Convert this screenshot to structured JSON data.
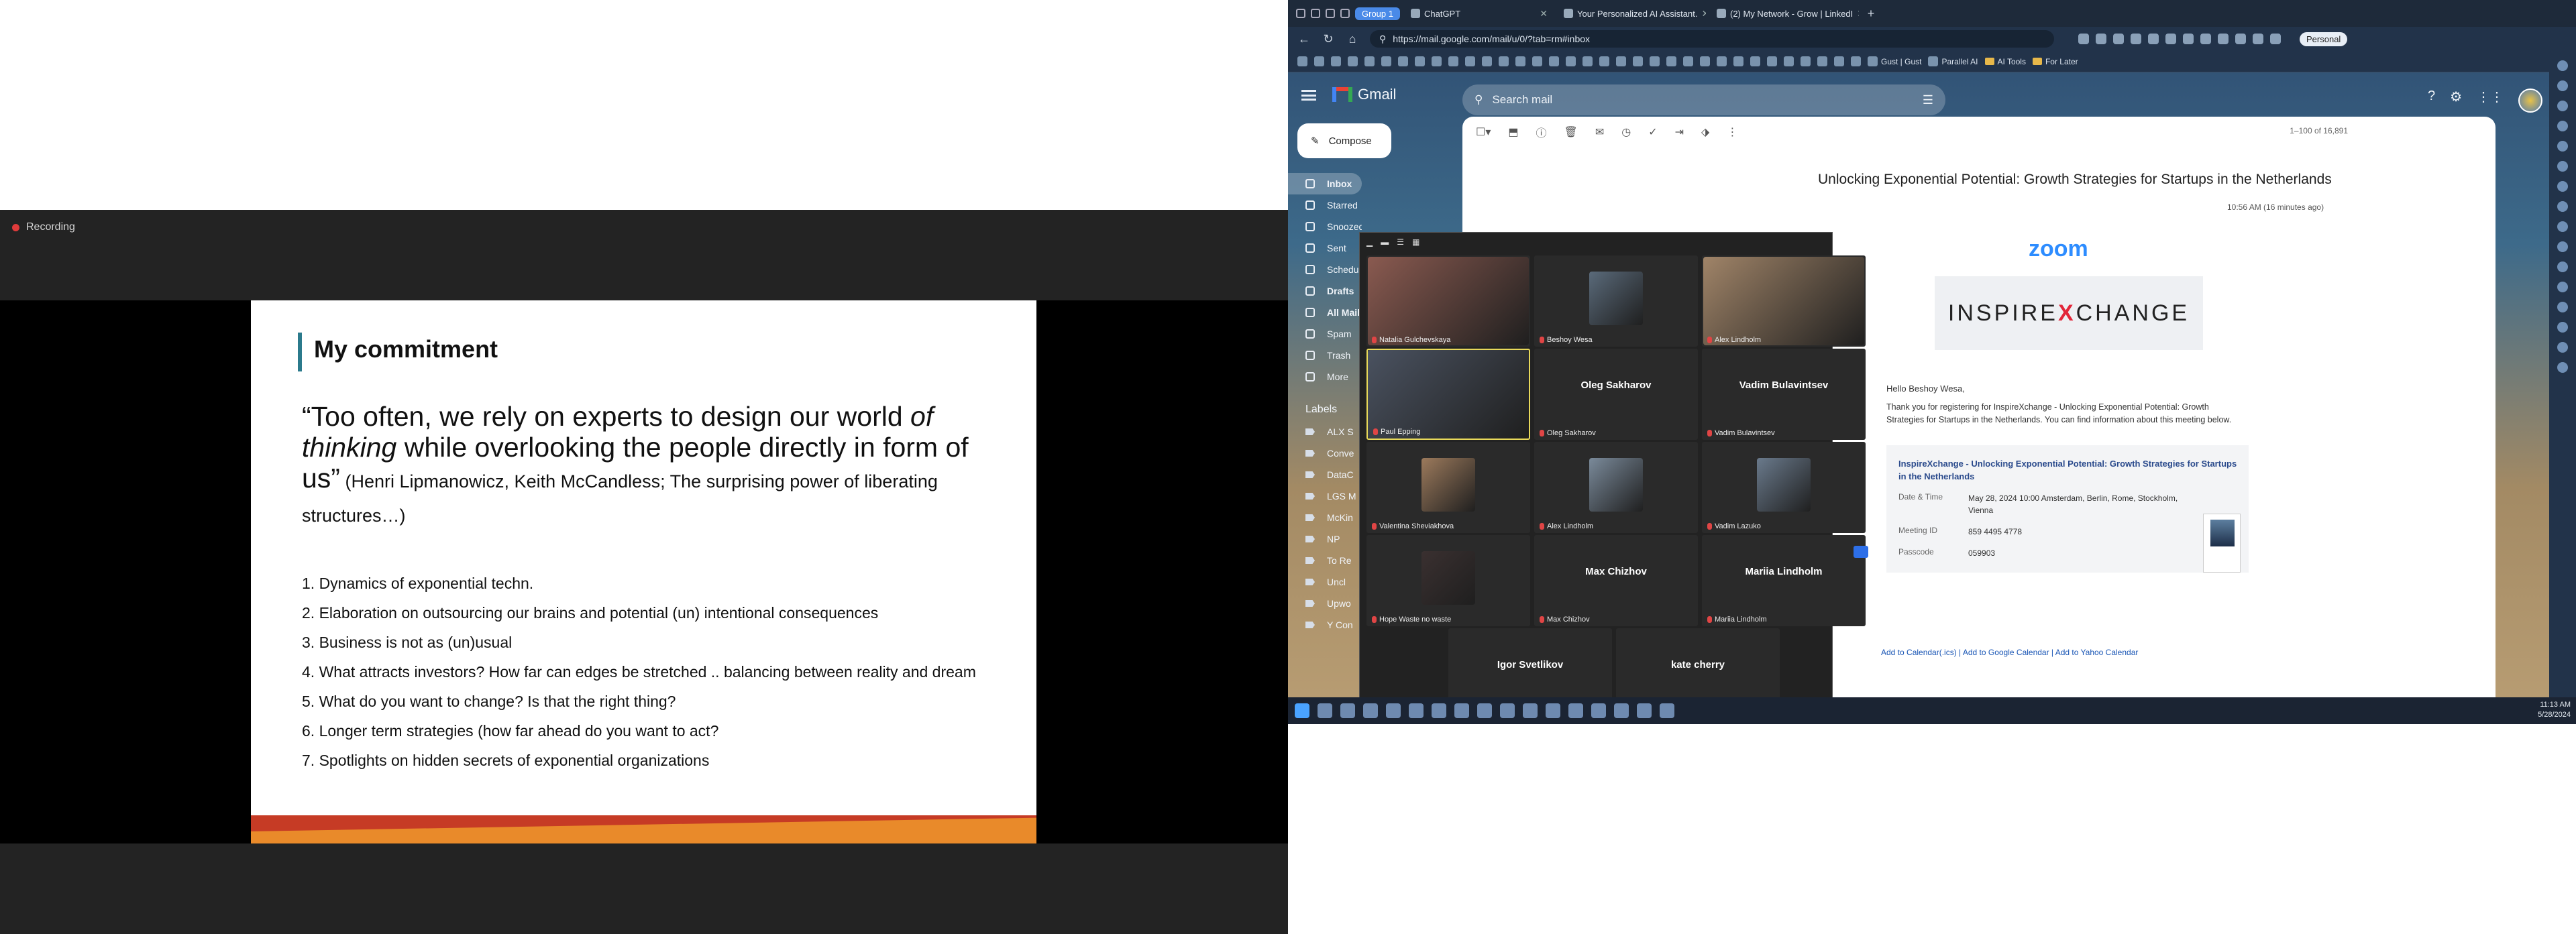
{
  "zoom": {
    "recording_label": "Recording",
    "slide": {
      "title": "My commitment",
      "quote_part1": "“Too often, we rely on experts to design our world ",
      "quote_em1": "of thinking",
      "quote_part2": " while overlooking the people directly in form of us”",
      "quote_cite": " (Henri Lipmanowicz, Keith McCandless; The surprising power of liberating structures…)",
      "items": [
        "1. Dynamics of exponential techn.",
        "2. Elaboration on outsourcing our brains and potential (un) intentional consequences",
        "3. Business is not as (un)usual",
        "4. What attracts investors? How far can edges be stretched .. balancing between reality and dream",
        "5. What do you want to change? Is that the right thing?",
        "6. Longer term strategies (how far ahead do you want to act?",
        "7. Spotlights on hidden secrets of exponential organizations"
      ]
    }
  },
  "browser": {
    "tab_group": "Group 1",
    "tabs": [
      "ChatGPT",
      "Your Personalized AI Assistant.",
      "(2) My Network - Grow | LinkedI"
    ],
    "url": "https://mail.google.com/mail/u/0/?tab=rm#inbox",
    "profile": "Personal",
    "bookmarks": [
      "Gust | Gust",
      "Parallel AI",
      "AI Tools",
      "For Later"
    ]
  },
  "gmail": {
    "app_name": "Gmail",
    "search_placeholder": "Search mail",
    "compose": "Compose",
    "nav": [
      "Inbox",
      "Starred",
      "Snoozed",
      "Sent",
      "Scheduled",
      "Drafts",
      "All Mail",
      "Spam",
      "Trash",
      "More"
    ],
    "labels_header": "Labels",
    "labels": [
      "ALX S",
      "Conve",
      "DataC",
      "LGS M",
      "McKin",
      "NP",
      "To Re",
      "Uncl",
      "Upwo",
      "Y Con"
    ],
    "count": "1–100 of 16,891",
    "subject": "Unlocking Exponential Potential: Growth Strategies for Startups in the Netherlands",
    "time": "10:56 AM (16 minutes ago)",
    "email": {
      "brand": "zoom",
      "banner_left": "INSPIRE",
      "banner_x": "X",
      "banner_right": "CHANGE",
      "greeting": "Hello Beshoy Wesa,",
      "thanks": "Thank you for registering for InspireXchange - Unlocking Exponential Potential: Growth Strategies for Startups in the Netherlands. You can find information about this meeting below.",
      "info_title": "InspireXchange - Unlocking Exponential Potential: Growth Strategies for Startups in the Netherlands",
      "date_key": "Date & Time",
      "date_val": "May 28, 2024 10:00 Amsterdam, Berlin, Rome, Stockholm, Vienna",
      "id_key": "Meeting ID",
      "id_val": "859 4495 4778",
      "pass_key": "Passcode",
      "pass_val": "059903",
      "cal_links": "Add to Calendar(.ics)  |  Add to Google Calendar  |  Add to Yahoo Calendar"
    }
  },
  "gallery": {
    "participants": [
      {
        "name": "Natalia Gulchevskaya",
        "big": false,
        "photo": "#8a5a50"
      },
      {
        "name": "Beshoy Wesa",
        "big": false,
        "photo": "#5a6a7a"
      },
      {
        "name": "Alex Lindholm",
        "big": false,
        "photo": "#a08468"
      },
      {
        "name": "Paul Epping",
        "big": false,
        "photo": "#4a5260"
      },
      {
        "name": "Oleg Sakharov",
        "big": true,
        "photo": ""
      },
      {
        "name": "Vadim Bulavintsev",
        "big": true,
        "photo": ""
      },
      {
        "name": "Valentina Sheviakhova",
        "big": false,
        "photo": "#9c7a5c"
      },
      {
        "name": "Alex Lindholm",
        "big": false,
        "photo": "#7a8a9a"
      },
      {
        "name": "Vadim Lazuko",
        "big": false,
        "photo": "#6a7a8c"
      },
      {
        "name": "Hope Waste no waste",
        "big": false,
        "photo": "#3a3030"
      },
      {
        "name": "Max Chizhov",
        "big": true,
        "photo": ""
      },
      {
        "name": "Mariia Lindholm",
        "big": true,
        "photo": ""
      },
      {
        "name": "Igor Svetlikov",
        "big": true,
        "photo": ""
      },
      {
        "name": "kate cherry",
        "big": true,
        "photo": ""
      }
    ]
  },
  "taskbar": {
    "time": "11:13 AM",
    "date": "5/28/2024"
  }
}
